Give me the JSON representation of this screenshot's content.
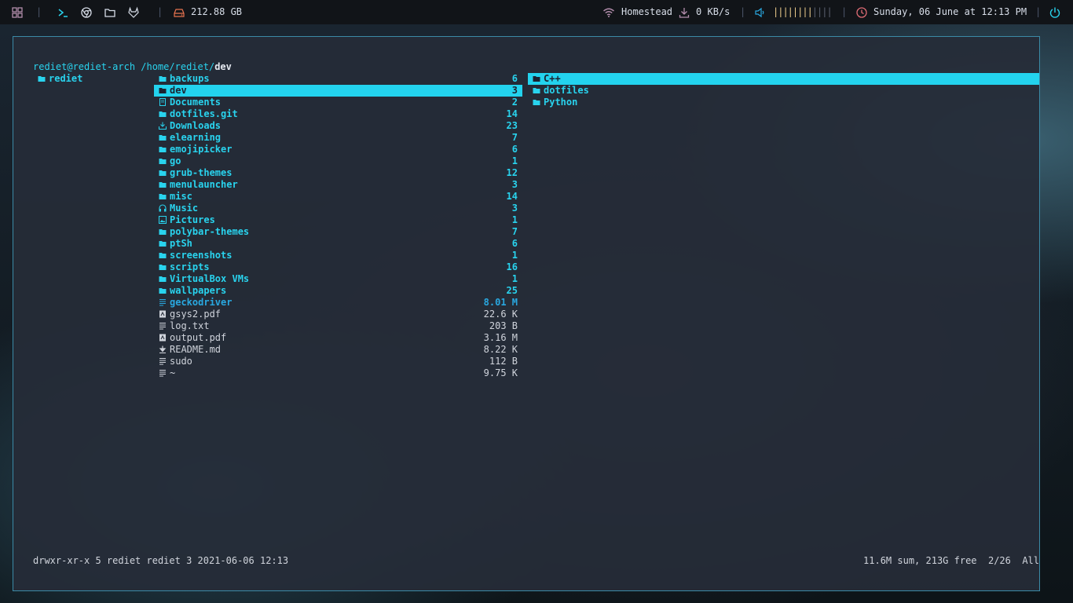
{
  "topbar": {
    "disk": "212.88 GB",
    "network_name": "Homestead",
    "net_speed": "0 KB/s",
    "volume_bars": "||||||||||",
    "datetime": "Sunday, 06 June at 12:13 PM",
    "colors": {
      "accent": "#29d3ee",
      "disk": "#e8734f",
      "wifi": "#b48ead",
      "volume": "#ebcb8b",
      "clock": "#e06c75",
      "power": "#29d3ee"
    }
  },
  "prompt": {
    "user_host": "rediet@rediet-arch",
    "path_prefix": "/home/rediet/",
    "path_current": "dev"
  },
  "parent_col": [
    {
      "name": "rediet",
      "icon": "folder-icon"
    }
  ],
  "main_col": [
    {
      "name": "backups",
      "size": "6",
      "type": "dir",
      "icon": "folder-icon"
    },
    {
      "name": "dev",
      "size": "3",
      "type": "dir",
      "icon": "folder-icon",
      "selected": true
    },
    {
      "name": "Documents",
      "size": "2",
      "type": "dir",
      "icon": "document-icon"
    },
    {
      "name": "dotfiles.git",
      "size": "14",
      "type": "dir",
      "icon": "folder-icon"
    },
    {
      "name": "Downloads",
      "size": "23",
      "type": "dir",
      "icon": "download-icon"
    },
    {
      "name": "elearning",
      "size": "7",
      "type": "dir",
      "icon": "folder-icon"
    },
    {
      "name": "emojipicker",
      "size": "6",
      "type": "dir",
      "icon": "folder-icon"
    },
    {
      "name": "go",
      "size": "1",
      "type": "dir",
      "icon": "folder-icon"
    },
    {
      "name": "grub-themes",
      "size": "12",
      "type": "dir",
      "icon": "folder-icon"
    },
    {
      "name": "menulauncher",
      "size": "3",
      "type": "dir",
      "icon": "folder-icon"
    },
    {
      "name": "misc",
      "size": "14",
      "type": "dir",
      "icon": "folder-icon"
    },
    {
      "name": "Music",
      "size": "3",
      "type": "dir",
      "icon": "headphones-icon"
    },
    {
      "name": "Pictures",
      "size": "1",
      "type": "dir",
      "icon": "image-icon"
    },
    {
      "name": "polybar-themes",
      "size": "7",
      "type": "dir",
      "icon": "folder-icon"
    },
    {
      "name": "ptSh",
      "size": "6",
      "type": "dir",
      "icon": "folder-icon"
    },
    {
      "name": "screenshots",
      "size": "1",
      "type": "dir",
      "icon": "folder-icon"
    },
    {
      "name": "scripts",
      "size": "16",
      "type": "dir",
      "icon": "folder-icon"
    },
    {
      "name": "VirtualBox VMs",
      "size": "1",
      "type": "dir",
      "icon": "folder-icon"
    },
    {
      "name": "wallpapers",
      "size": "25",
      "type": "dir",
      "icon": "folder-icon"
    },
    {
      "name": "geckodriver",
      "size": "8.01 M",
      "type": "exec",
      "icon": "file-text-icon"
    },
    {
      "name": "gsys2.pdf",
      "size": "22.6 K",
      "type": "file",
      "icon": "pdf-icon"
    },
    {
      "name": "log.txt",
      "size": "203 B",
      "type": "file",
      "icon": "file-text-icon"
    },
    {
      "name": "output.pdf",
      "size": "3.16 M",
      "type": "file",
      "icon": "pdf-icon"
    },
    {
      "name": "README.md",
      "size": "8.22 K",
      "type": "file",
      "icon": "markdown-icon"
    },
    {
      "name": "sudo",
      "size": "112 B",
      "type": "file",
      "icon": "file-text-icon"
    },
    {
      "name": "~",
      "size": "9.75 K",
      "type": "file",
      "icon": "file-text-icon"
    }
  ],
  "preview_col": [
    {
      "name": "C++",
      "icon": "folder-icon",
      "selected": true
    },
    {
      "name": "dotfiles",
      "icon": "folder-icon"
    },
    {
      "name": "Python",
      "icon": "folder-icon"
    }
  ],
  "status": {
    "left": "drwxr-xr-x 5 rediet rediet 3 2021-06-06 12:13",
    "right": "11.6M sum, 213G free  2/26  All"
  }
}
